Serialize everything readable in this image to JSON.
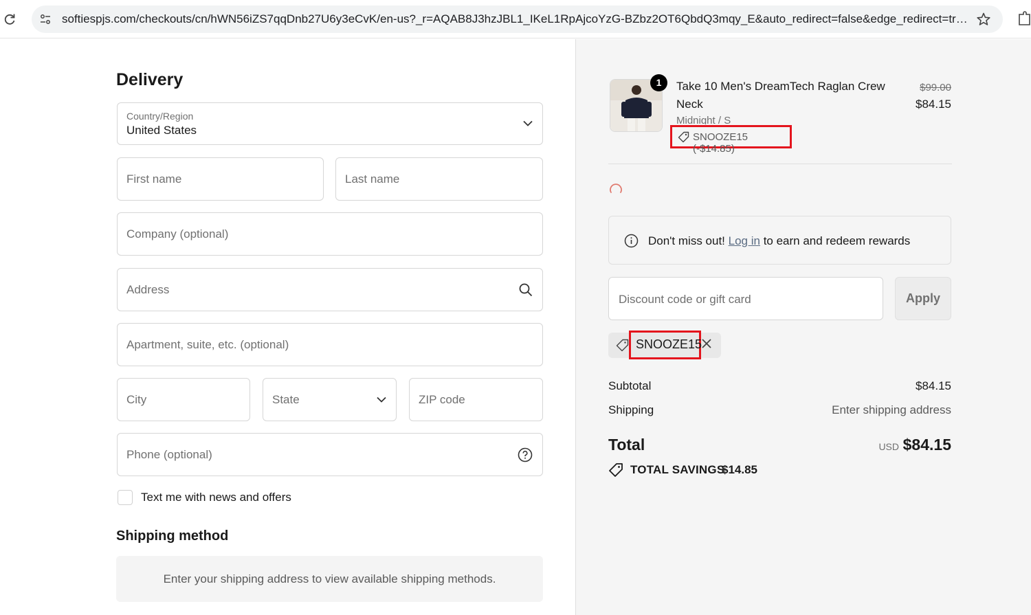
{
  "browser": {
    "url": "softiespjs.com/checkouts/cn/hWN56iZS7qqDnb27U6y3eCvK/en-us?_r=AQAB8J3hzJBL1_IKeL1RpAjcoYzG-BZbz2OT6QbdQ3mqy_E&auto_redirect=false&edge_redirect=tru..."
  },
  "delivery": {
    "heading": "Delivery",
    "country_label": "Country/Region",
    "country_value": "United States",
    "first_name_placeholder": "First name",
    "last_name_placeholder": "Last name",
    "company_placeholder": "Company (optional)",
    "address_placeholder": "Address",
    "apartment_placeholder": "Apartment, suite, etc. (optional)",
    "city_placeholder": "City",
    "state_placeholder": "State",
    "zip_placeholder": "ZIP code",
    "phone_placeholder": "Phone (optional)",
    "text_me_label": "Text me with news and offers"
  },
  "shipping_method": {
    "heading": "Shipping method",
    "message": "Enter your shipping address to view available shipping methods."
  },
  "order": {
    "product": {
      "quantity": "1",
      "name": "Take 10 Men's DreamTech Raglan Crew Neck",
      "variant": "Midnight / S",
      "discount": "SNOOZE15 (-$14.85)",
      "original_price": "$99.00",
      "price": "$84.15"
    },
    "rewards": {
      "prefix": "Don't miss out!",
      "link": "Log in",
      "suffix": "to earn and redeem rewards"
    },
    "discount_placeholder": "Discount code or gift card",
    "apply_label": "Apply",
    "applied_code": "SNOOZE15",
    "subtotal_label": "Subtotal",
    "subtotal_value": "$84.15",
    "shipping_label": "Shipping",
    "shipping_value": "Enter shipping address",
    "total_label": "Total",
    "total_currency": "USD",
    "total_value": "$84.15",
    "savings_label": "TOTAL SAVINGS",
    "savings_value": "$14.85"
  },
  "colors": {
    "highlight": "#e4141d",
    "sidebar_bg": "#f5f5f5"
  }
}
